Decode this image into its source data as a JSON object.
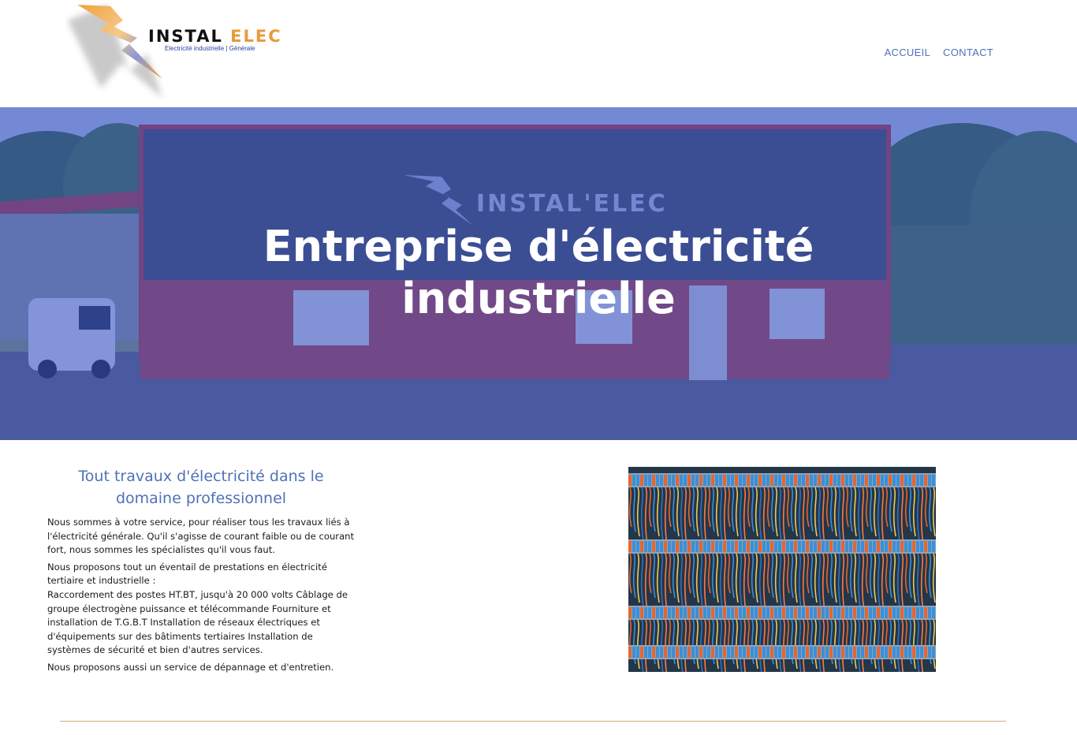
{
  "header": {
    "logo": {
      "title_main": "INSTAL ",
      "title_accent": "ELEC",
      "tagline": "Electricité industrielle | Générale"
    },
    "nav": [
      {
        "label": "ACCUEIL"
      },
      {
        "label": "CONTACT"
      }
    ]
  },
  "hero": {
    "title_line1": "Entreprise d'électricité",
    "title_line2": "industrielle",
    "background_image": "building-with-instal-elec-sign",
    "overlay_color": "#304cc8"
  },
  "main": {
    "heading": "Tout travaux d'électricité dans le domaine professionnel",
    "paragraphs": [
      "Nous sommes à votre service, pour réaliser tous les travaux liés à l'électricité générale. Qu'il s'agisse de courant faible ou de courant fort, nous sommes les spécialistes qu'il vous faut.",
      "Nous proposons tout un éventail de prestations en électricité tertiaire et industrielle :",
      "Raccordement des postes HT.BT, jusqu'à 20 000 volts Câblage de groupe électrogène puissance et télécommande Fourniture et installation de T.G.B.T Installation de réseaux électriques et d'équipements sur des bâtiments tertiaires Installation de systèmes de sécurité et bien d'autres services.",
      "Nous proposons aussi un service de dépannage et d'entretien."
    ],
    "photo": "electrical-wiring-terminal-blocks"
  },
  "colors": {
    "accent_blue": "#4d72b8",
    "divider_gold": "#d4ae78",
    "logo_orange": "#e89a3c"
  }
}
